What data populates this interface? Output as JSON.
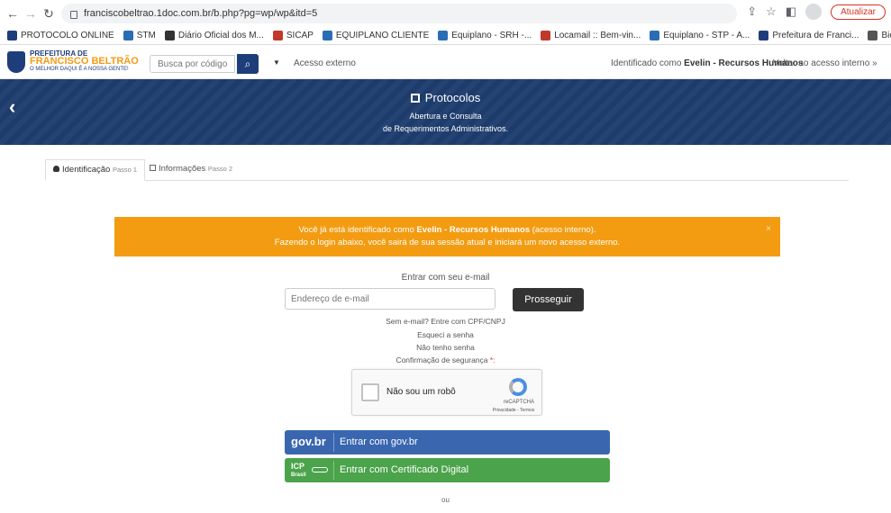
{
  "browser": {
    "url": "franciscobeltrao.1doc.com.br/b.php?pg=wp/wp&itd=5",
    "update_label": "Atualizar",
    "bookmarks": [
      {
        "label": "PROTOCOLO ONLINE",
        "color": "#1e3d7b"
      },
      {
        "label": "STM",
        "color": "#2a6db5"
      },
      {
        "label": "Diário Oficial dos M...",
        "color": "#333333"
      },
      {
        "label": "SICAP",
        "color": "#c0392b"
      },
      {
        "label": "EQUIPLANO CLIENTE",
        "color": "#2a6db5"
      },
      {
        "label": "Equiplano - SRH -...",
        "color": "#2a6db5"
      },
      {
        "label": "Locamail :: Bem-vin...",
        "color": "#c0392b"
      },
      {
        "label": "Equiplano - STP - A...",
        "color": "#2a6db5"
      },
      {
        "label": "Prefeitura de Franci...",
        "color": "#1e3d7b"
      },
      {
        "label": "BioFinger.Net",
        "color": "#555555"
      }
    ]
  },
  "header": {
    "logo_line1": "PREFEITURA DE",
    "logo_line2": "FRANCISCO BELTRÃO",
    "logo_line3": "O MELHOR DAQUI É A NOSSA GENTE!",
    "search_placeholder": "Busca por código",
    "external_access": "Acesso externo",
    "identified_prefix": "Identificado como ",
    "identified_user": "Evelin - Recursos Humanos",
    "back_internal": "Voltar ao acesso interno »"
  },
  "banner": {
    "title": "Protocolos",
    "subtitle1": "Abertura e Consulta",
    "subtitle2": "de Requerimentos Administrativos."
  },
  "tabs": [
    {
      "label": "Identificação",
      "step": "Passo 1"
    },
    {
      "label": "Informações",
      "step": "Passo 2"
    }
  ],
  "alert": {
    "line1_pre": "Você já está identificado como ",
    "line1_user": "Evelin - Recursos Humanos",
    "line1_post": " (acesso interno).",
    "line2": "Fazendo o login abaixo, você sairá de sua sessão atual e iniciará um novo acesso externo.",
    "close": "×"
  },
  "login": {
    "title": "Entrar com seu e-mail",
    "email_placeholder": "Endereço de e-mail",
    "submit": "Prosseguir",
    "no_email": "Sem e-mail? Entre com CPF/CNPJ",
    "forgot": "Esqueci a senha",
    "no_password": "Não tenho senha",
    "security": "Confirmação de segurança",
    "required_mark": "*:"
  },
  "captcha": {
    "label": "Não sou um robô",
    "brand": "reCAPTCHA",
    "privacy": "Privacidade - Termos"
  },
  "govbr": {
    "logo": "gov.br",
    "label": "Entrar com gov.br"
  },
  "icp": {
    "logo_top": "ICP",
    "logo_bottom": "Brasil",
    "label": "Entrar com Certificado Digital"
  },
  "or": "ou"
}
